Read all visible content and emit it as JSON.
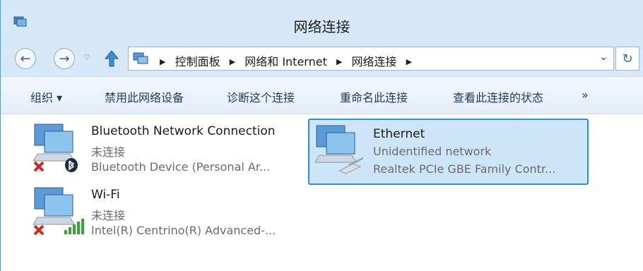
{
  "window": {
    "title": "网络连接"
  },
  "nav": {
    "back_icon": "back-arrow-icon",
    "forward_icon": "forward-arrow-icon",
    "up_icon": "up-arrow-icon",
    "breadcrumbs": [
      "控制面板",
      "网络和 Internet",
      "网络连接"
    ]
  },
  "toolbar": {
    "organize": "组织 ▾",
    "disable": "禁用此网络设备",
    "diagnose": "诊断这个连接",
    "rename": "重命名此连接",
    "status": "查看此连接的状态",
    "more": "»"
  },
  "connections": [
    {
      "name": "Bluetooth Network Connection",
      "status": "未连接",
      "device": "Bluetooth Device (Personal Ar...",
      "icon": "bluetooth-network-icon"
    },
    {
      "name": "Ethernet",
      "status": "Unidentified network",
      "device": "Realtek PCIe GBE Family Contr...",
      "icon": "ethernet-network-icon",
      "selected": true
    },
    {
      "name": "Wi-Fi",
      "status": "未连接",
      "device": "Intel(R) Centrino(R) Advanced-...",
      "icon": "wifi-network-icon"
    }
  ],
  "colors": {
    "selection_border": "#2b8fd9",
    "selection_fill": "#cde6f7",
    "error_x": "#d02a1f",
    "wifi_green": "#3aa33a"
  }
}
